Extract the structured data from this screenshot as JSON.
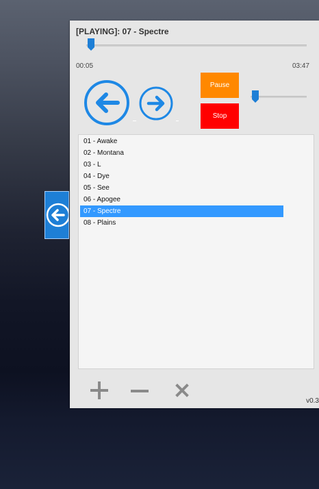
{
  "player": {
    "title": "[PLAYING]: 07 - Spectre",
    "current_time": "00:05",
    "total_time": "03:47",
    "seek_progress": 0.022,
    "volume_level": 0.08,
    "pause_label": "Pause",
    "stop_label": "Stop",
    "version": "v0.3"
  },
  "playlist": {
    "selected_index": 6,
    "tracks": [
      "01 - Awake",
      "02 - Montana",
      "03 - L",
      "04 - Dye",
      "05 - See",
      "06 - Apogee",
      "07 - Spectre",
      "08 - Plains"
    ]
  },
  "colors": {
    "accent": "#1e88e5",
    "pause": "#ff8800",
    "stop": "#ff0000",
    "selection": "#3399ff",
    "icon_gray": "#8a8a8a"
  },
  "icons": {
    "side_tab": "arrow-left-circle-icon",
    "prev": "arrow-left-circle-icon",
    "next": "arrow-right-circle-icon",
    "add": "plus-icon",
    "remove": "minus-icon",
    "clear": "close-icon"
  }
}
